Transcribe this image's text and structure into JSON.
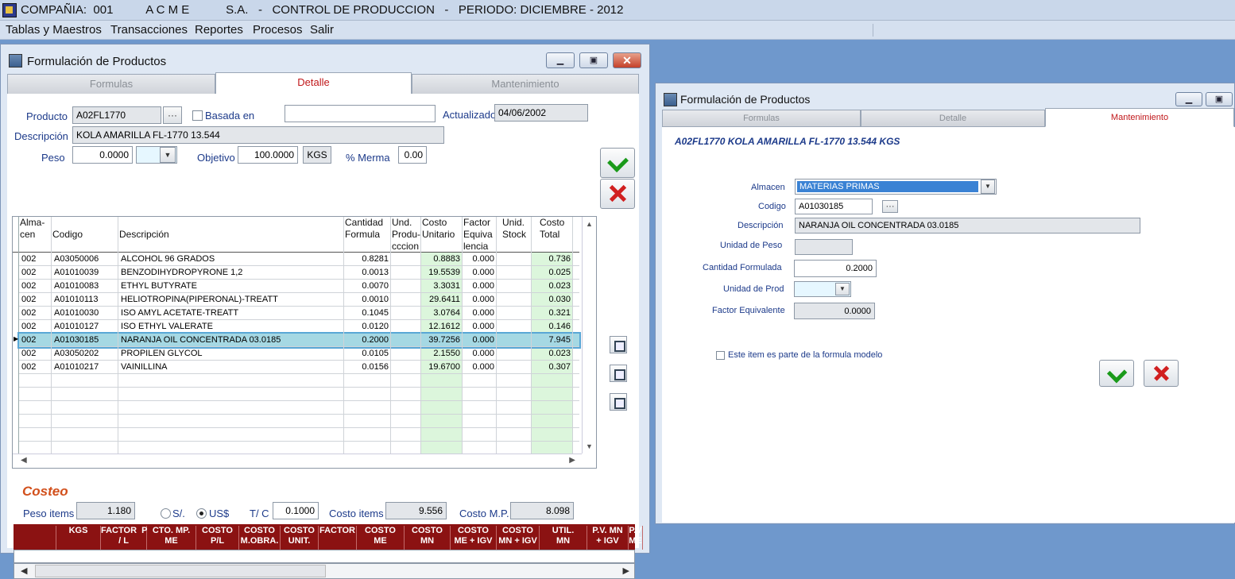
{
  "app": {
    "title": "COMPAÑIA:  001          A C M E           S.A.   -   CONTROL DE PRODUCCION   -   PERIODO: DICIEMBRE - 2012"
  },
  "menu": [
    "Tablas y Maestros",
    "Transacciones",
    "Reportes",
    "Procesos",
    "Salir"
  ],
  "win1": {
    "title": "Formulación de Productos",
    "tabs": [
      "Formulas",
      "Detalle",
      "Mantenimiento"
    ],
    "producto_label": "Producto",
    "producto": "A02FL1770",
    "ellipsis": "···",
    "basada_label": "Basada en",
    "actualizado_label": "Actualizado",
    "actualizado": "04/06/2002",
    "descripcion_label": "Descripción",
    "descripcion": "KOLA AMARILLA FL-1770 13.544",
    "peso_label": "Peso",
    "peso": "0.0000",
    "objetivo_label": "Objetivo",
    "objetivo": "100.0000",
    "kgs": "KGS",
    "merma_label": "%  Merma",
    "merma": "0.00",
    "columns": [
      "Alma-\ncen",
      "Codigo",
      "Descripción",
      "Cantidad\nFormula",
      "Und.\nProdu-\ncccion",
      "Costo\nUnitario",
      "Factor\nEquiva\nlencia",
      "Unid.\nStock",
      "Costo\nTotal"
    ],
    "rows": [
      {
        "alm": "002",
        "cod": "A03050006",
        "desc": "ALCOHOL  96  GRADOS",
        "cant": "0.8281",
        "costo": "0.8883",
        "factor": "0.000",
        "total": "0.736"
      },
      {
        "alm": "002",
        "cod": "A01010039",
        "desc": "BENZODIHYDROPYRONE 1,2",
        "cant": "0.0013",
        "costo": "19.5539",
        "factor": "0.000",
        "total": "0.025"
      },
      {
        "alm": "002",
        "cod": "A01010083",
        "desc": "ETHYL BUTYRATE",
        "cant": "0.0070",
        "costo": "3.3031",
        "factor": "0.000",
        "total": "0.023"
      },
      {
        "alm": "002",
        "cod": "A01010113",
        "desc": "HELIOTROPINA(PIPERONAL)-TREATT",
        "cant": "0.0010",
        "costo": "29.6411",
        "factor": "0.000",
        "total": "0.030"
      },
      {
        "alm": "002",
        "cod": "A01010030",
        "desc": "ISO AMYL ACETATE-TREATT",
        "cant": "0.1045",
        "costo": "3.0764",
        "factor": "0.000",
        "total": "0.321"
      },
      {
        "alm": "002",
        "cod": "A01010127",
        "desc": "ISO ETHYL VALERATE",
        "cant": "0.0120",
        "costo": "12.1612",
        "factor": "0.000",
        "total": "0.146"
      },
      {
        "alm": "002",
        "cod": "A01030185",
        "desc": "NARANJA OIL CONCENTRADA 03.0185",
        "cant": "0.2000",
        "costo": "39.7256",
        "factor": "0.000",
        "total": "7.945"
      },
      {
        "alm": "002",
        "cod": "A03050202",
        "desc": "PROPILEN GLYCOL",
        "cant": "0.0105",
        "costo": "2.1550",
        "factor": "0.000",
        "total": "0.023"
      },
      {
        "alm": "002",
        "cod": "A01010217",
        "desc": "VAINILLINA",
        "cant": "0.0156",
        "costo": "19.6700",
        "factor": "0.000",
        "total": "0.307"
      }
    ],
    "costeo_title": "Costeo",
    "peso_items_label": "Peso items",
    "peso_items": "1.180",
    "soles": "S/.",
    "dolares": "US$",
    "tc_label": "T/ C",
    "tc": "0.1000",
    "costo_items_label": "Costo items",
    "costo_items": "9.556",
    "costo_mp_label": "Costo M.P.",
    "costo_mp": "8.098",
    "cost_cols": [
      "",
      "KGS",
      "FACTOR  P\n/ L",
      "CTO. MP.\nME",
      "COSTO\nP/L",
      "COSTO\nM.OBRA.",
      "COSTO\nUNIT.",
      "FACTOR",
      "COSTO\nME",
      "COSTO\nMN",
      "COSTO\nME + IGV",
      "COSTO\nMN + IGV",
      "UTIL.\nMN",
      "P.V. MN\n+ IGV",
      "P.V\nME"
    ]
  },
  "win2": {
    "title": "Formulación de Productos",
    "tabs": [
      "Formulas",
      "Detalle",
      "Mantenimiento"
    ],
    "heading": "A02FL1770 KOLA AMARILLA FL-1770 13.544 KGS",
    "almacen_label": "Almacen",
    "almacen": "MATERIAS PRIMAS",
    "codigo_label": "Codigo",
    "codigo": "A01030185",
    "ellipsis": "···",
    "descripcion_label": "Descripción",
    "descripcion": "NARANJA OIL CONCENTRADA 03.0185",
    "unidad_peso_label": "Unidad de Peso",
    "cantidad_label": "Cantidad Formulada",
    "cantidad": "0.2000",
    "unidad_prod_label": "Unidad de Prod",
    "factor_label": "Factor Equivalente",
    "factor": "0.0000",
    "modelo_label": "Este item es parte de la formula modelo"
  }
}
